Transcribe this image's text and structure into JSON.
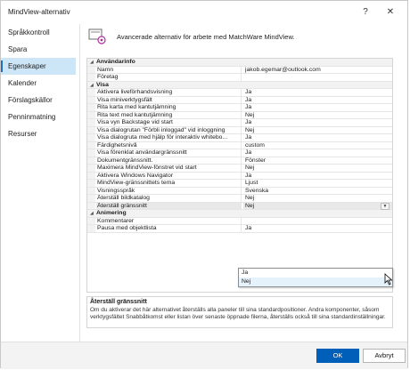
{
  "window": {
    "title": "MindView-alternativ",
    "help_glyph": "?",
    "close_glyph": "✕"
  },
  "sidebar": {
    "items": [
      {
        "label": "Språkkontroll"
      },
      {
        "label": "Spara"
      },
      {
        "label": "Egenskaper",
        "active": true
      },
      {
        "label": "Kalender"
      },
      {
        "label": "Förslagskällor"
      },
      {
        "label": "Penninmatning"
      },
      {
        "label": "Resurser"
      }
    ]
  },
  "header": {
    "text": "Avancerade alternativ för arbete med MatchWare MindView."
  },
  "grid": {
    "cat_anvandarinfo": "Användarinfo",
    "namn": {
      "name": "Namn",
      "value": "jakob.egemar@outlook.com"
    },
    "foretag": {
      "name": "Företag",
      "value": ""
    },
    "cat_visa": "Visa",
    "rows": [
      {
        "name": "Aktivera liveförhandsvisning",
        "value": "Ja"
      },
      {
        "name": "Visa miniverktygsfält",
        "value": "Ja"
      },
      {
        "name": "Rita karta med kantutjämning",
        "value": "Ja"
      },
      {
        "name": "Rita text med kantutjämning",
        "value": "Nej"
      },
      {
        "name": "Visa vyn Backstage vid start",
        "value": "Ja"
      },
      {
        "name": "Visa dialogrutan \"Förbli inloggad\" vid inloggning",
        "value": "Nej"
      },
      {
        "name": "Visa dialogruta med hjälp för interaktiv whitebo...",
        "value": "Ja"
      },
      {
        "name": "Färdighetsnivå",
        "value": "custom"
      },
      {
        "name": "Visa förenklat användargränssnitt",
        "value": "Ja"
      },
      {
        "name": "Dokumentgränssnitt.",
        "value": "Fönster"
      },
      {
        "name": "Maximera MindView-fönstret vid start",
        "value": "Nej"
      },
      {
        "name": "Aktivera Windows Navigator",
        "value": "Ja"
      },
      {
        "name": "MindView-gränssnittets tema",
        "value": "Ljust"
      },
      {
        "name": "Visningsspråk",
        "value": "Svenska"
      },
      {
        "name": "Återställ bildkatalog",
        "value": "Nej"
      }
    ],
    "selected": {
      "name": "Återställ gränssnitt",
      "value": "Nej"
    },
    "cat_animering": "Animering",
    "kommentarer": {
      "name": "Kommentarer",
      "value": ""
    },
    "partial": {
      "name": "Pausa med objektlista",
      "value": "Ja"
    }
  },
  "dropdown": {
    "options": [
      "Ja",
      "Nej"
    ],
    "hover_option": "Nej"
  },
  "description": {
    "title": "Återställ gränssnitt",
    "text": "Om du aktiverar det här alternativet återställs alla paneler till sina standardpositioner. Andra komponenter, såsom verktygsfältet Snabbåtkomst eller listan över senaste öppnade filerna, återställs också till sina standardinställningar."
  },
  "footer": {
    "ok_label": "OK",
    "cancel_label": "Avbryt"
  },
  "colors": {
    "accent": "#005fb8",
    "active_bg": "#cde6f7"
  }
}
